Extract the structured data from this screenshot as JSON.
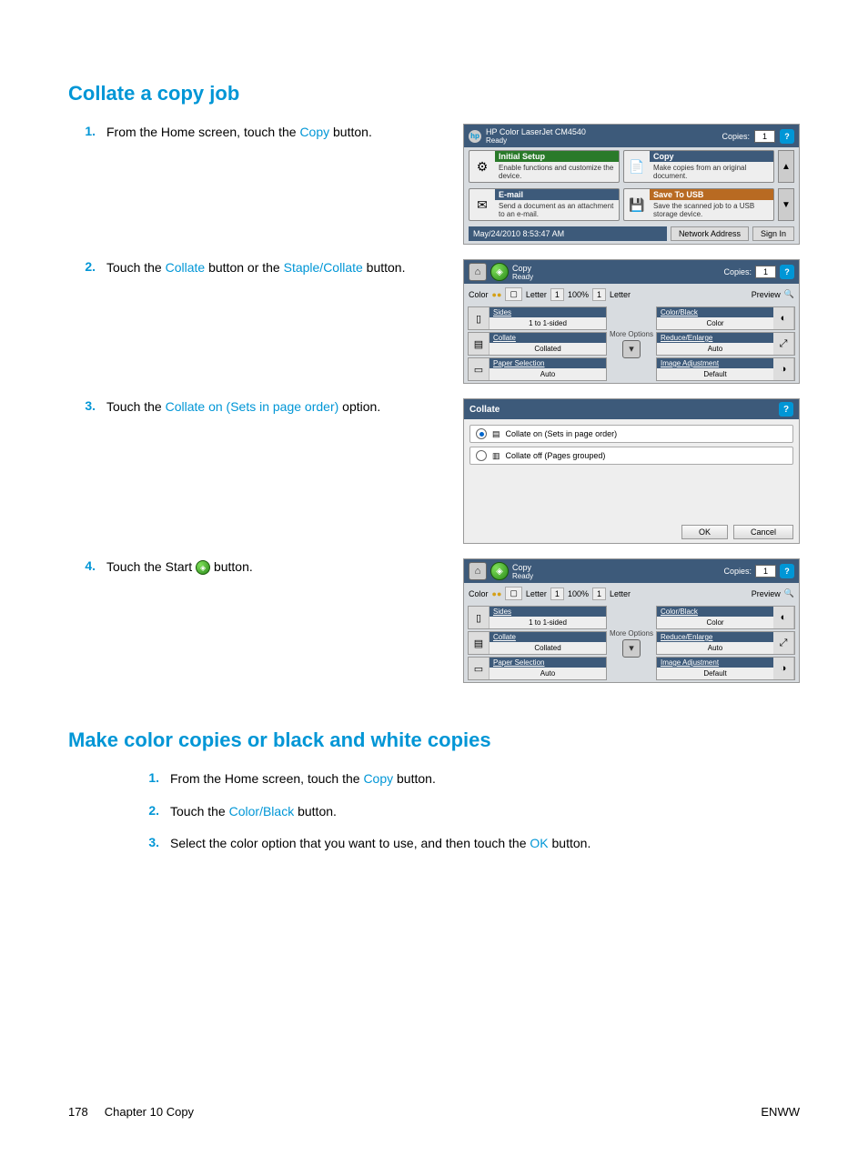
{
  "section1": {
    "heading": "Collate a copy job",
    "steps": {
      "1": {
        "num": "1.",
        "pre": "From the Home screen, touch the ",
        "link": "Copy",
        "post": " button."
      },
      "2": {
        "num": "2.",
        "pre": "Touch the ",
        "link1": "Collate",
        "mid": " button or the ",
        "link2": "Staple/Collate",
        "post": " button."
      },
      "3": {
        "num": "3.",
        "pre": "Touch the ",
        "link": "Collate on (Sets in page order)",
        "post": " option."
      },
      "4": {
        "num": "4.",
        "pre": "Touch the Start ",
        "post": " button."
      }
    }
  },
  "section2": {
    "heading": "Make color copies or black and white copies",
    "steps": {
      "1": {
        "num": "1.",
        "pre": "From the Home screen, touch the ",
        "link": "Copy",
        "post": " button."
      },
      "2": {
        "num": "2.",
        "pre": "Touch the ",
        "link": "Color/Black",
        "post": " button."
      },
      "3": {
        "num": "3.",
        "pre": "Select the color option that you want to use, and then touch the ",
        "link": "OK",
        "post": " button."
      }
    }
  },
  "footer": {
    "page": "178",
    "chapter": "Chapter 10   Copy",
    "right": "ENWW"
  },
  "hs": {
    "title": "HP Color LaserJet CM4540",
    "ready": "Ready",
    "copies_label": "Copies:",
    "copies_val": "1",
    "tiles": {
      "initial": {
        "title": "Initial Setup",
        "desc": "Enable functions and customize the device."
      },
      "copy": {
        "title": "Copy",
        "desc": "Make copies from an original document."
      },
      "email": {
        "title": "E-mail",
        "desc": "Send a document as an attachment to an e-mail."
      },
      "usb": {
        "title": "Save To USB",
        "desc": "Save the scanned job to a USB storage device."
      }
    },
    "timestamp": "May/24/2010 8:53:47 AM",
    "net_btn": "Network Address",
    "signin_btn": "Sign In"
  },
  "co": {
    "title": "Copy",
    "ready": "Ready",
    "copies_label": "Copies:",
    "copies_val": "1",
    "color_label": "Color",
    "num1": "1",
    "pct": "100%",
    "num2": "1",
    "letter": "Letter",
    "preview": "Preview",
    "more": "More Options",
    "sides": {
      "title": "Sides",
      "val": "1 to 1-sided"
    },
    "collate": {
      "title": "Collate",
      "val": "Collated"
    },
    "paper": {
      "title": "Paper Selection",
      "val": "Auto"
    },
    "colorblack": {
      "title": "Color/Black",
      "val": "Color"
    },
    "reduce": {
      "title": "Reduce/Enlarge",
      "val": "Auto"
    },
    "image": {
      "title": "Image Adjustment",
      "val": "Default"
    }
  },
  "collate_screen": {
    "title": "Collate",
    "opt_on": "Collate on (Sets in page order)",
    "opt_off": "Collate off (Pages grouped)",
    "ok": "OK",
    "cancel": "Cancel"
  }
}
